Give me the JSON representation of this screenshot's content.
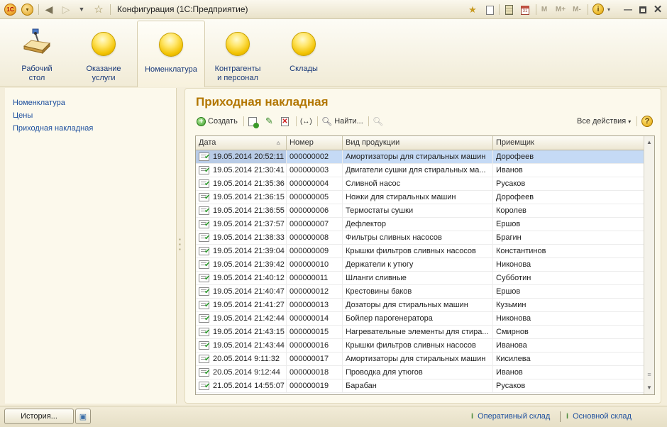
{
  "window": {
    "title": "Конфигурация  (1С:Предприятие)",
    "logo_text": "1С",
    "mem_labels": [
      "M",
      "M+",
      "M-"
    ]
  },
  "sections": [
    {
      "label": "Рабочий\nстол",
      "icon": "desktop-icon"
    },
    {
      "label": "Оказание\nуслуги",
      "icon": "circle-icon"
    },
    {
      "label": "Номенклатура",
      "icon": "circle-icon",
      "active": true
    },
    {
      "label": "Контрагенты\nи персонал",
      "icon": "circle-icon"
    },
    {
      "label": "Склады",
      "icon": "circle-icon"
    }
  ],
  "nav": {
    "items": [
      "Номенклатура",
      "Цены",
      "Приходная накладная"
    ]
  },
  "document": {
    "title": "Приходная накладная",
    "toolbar": {
      "create": "Создать",
      "find": "Найти...",
      "all_actions": "Все действия",
      "help": "?"
    },
    "columns": [
      "Дата",
      "Номер",
      "Вид продукции",
      "Приемщик"
    ],
    "rows": [
      {
        "date": "19.05.2014 20:52:11",
        "number": "000000002",
        "product": "Амортизаторы для стиральных машин",
        "receiver": "Дорофеев",
        "selected": true
      },
      {
        "date": "19.05.2014 21:30:41",
        "number": "000000003",
        "product": "Двигатели сушки для стиральных ма...",
        "receiver": "Иванов"
      },
      {
        "date": "19.05.2014 21:35:36",
        "number": "000000004",
        "product": "Сливной насос",
        "receiver": "Русаков"
      },
      {
        "date": "19.05.2014 21:36:15",
        "number": "000000005",
        "product": "Ножки для стиральных машин",
        "receiver": "Дорофеев"
      },
      {
        "date": "19.05.2014 21:36:55",
        "number": "000000006",
        "product": "Термостаты сушки",
        "receiver": "Королев"
      },
      {
        "date": "19.05.2014 21:37:57",
        "number": "000000007",
        "product": "Дефлектор",
        "receiver": "Ершов"
      },
      {
        "date": "19.05.2014 21:38:33",
        "number": "000000008",
        "product": "Фильтры сливных насосов",
        "receiver": "Брагин"
      },
      {
        "date": "19.05.2014 21:39:04",
        "number": "000000009",
        "product": "Крышки фильтров сливных насосов",
        "receiver": "Константинов"
      },
      {
        "date": "19.05.2014 21:39:42",
        "number": "000000010",
        "product": "Держатели к утюгу",
        "receiver": "Никонова"
      },
      {
        "date": "19.05.2014 21:40:12",
        "number": "000000011",
        "product": "Шланги сливные",
        "receiver": "Субботин"
      },
      {
        "date": "19.05.2014 21:40:47",
        "number": "000000012",
        "product": "Крестовины баков",
        "receiver": "Ершов"
      },
      {
        "date": "19.05.2014 21:41:27",
        "number": "000000013",
        "product": "Дозаторы для стиральных машин",
        "receiver": "Кузьмин"
      },
      {
        "date": "19.05.2014 21:42:44",
        "number": "000000014",
        "product": "Бойлер парогенератора",
        "receiver": "Никонова"
      },
      {
        "date": "19.05.2014 21:43:15",
        "number": "000000015",
        "product": "Нагревательные элементы для стира...",
        "receiver": "Смирнов"
      },
      {
        "date": "19.05.2014 21:43:44",
        "number": "000000016",
        "product": "Крышки фильтров сливных насосов",
        "receiver": "Иванова"
      },
      {
        "date": "20.05.2014 9:11:32",
        "number": "000000017",
        "product": "Амортизаторы для стиральных машин",
        "receiver": "Кисилева"
      },
      {
        "date": "20.05.2014 9:12:44",
        "number": "000000018",
        "product": "Проводка для утюгов",
        "receiver": "Иванов"
      },
      {
        "date": "21.05.2014 14:55:07",
        "number": "000000019",
        "product": "Барабан",
        "receiver": "Русаков"
      }
    ]
  },
  "statusbar": {
    "history": "История...",
    "links": [
      "Оперативный склад",
      "Основной склад"
    ]
  },
  "colors": {
    "title_accent": "#b27600",
    "link": "#1d4f9e",
    "selection": "#c5daf5"
  }
}
